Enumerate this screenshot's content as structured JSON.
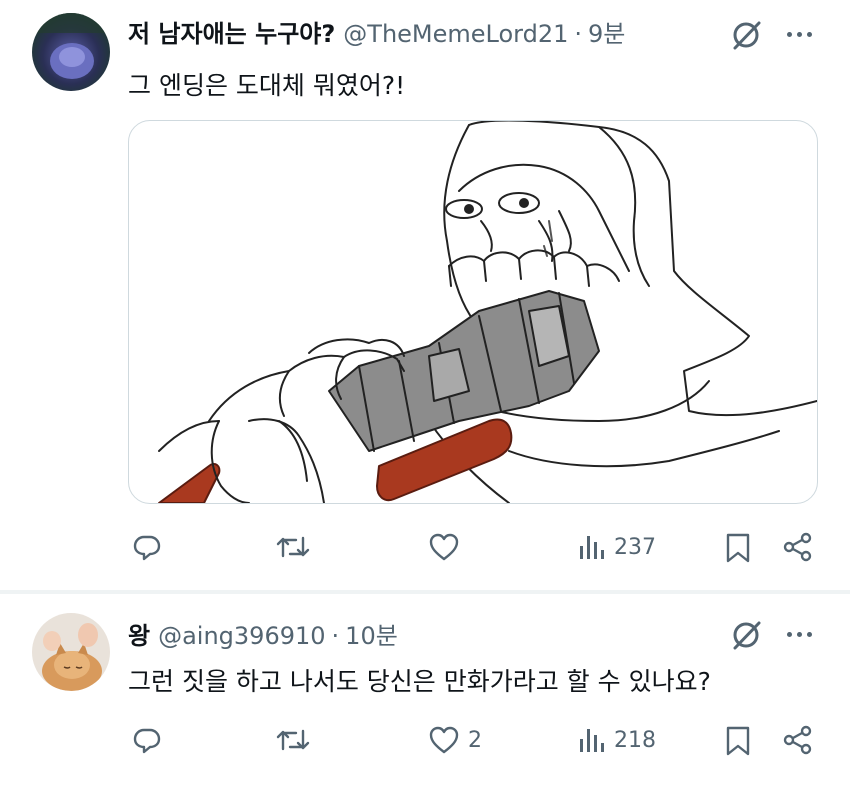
{
  "tweets": [
    {
      "author": "저 남자애는 누구야?",
      "handle": "@TheMemeLord21",
      "time": "9분",
      "text": "그 엔딩은 도대체 뭐였어?!",
      "likes": "",
      "views": "237"
    },
    {
      "author": "왕",
      "handle": "@aing396910",
      "time": "10분",
      "text": "그런 짓을 하고 나서도 당신은 만화가라고 할 수 있나요?",
      "likes": "2",
      "views": "218"
    }
  ],
  "separator": "·",
  "icons": {
    "reply": "reply-icon",
    "retweet": "retweet-icon",
    "like": "heart-icon",
    "views": "views-bar-icon",
    "bookmark": "bookmark-icon",
    "share": "share-icon",
    "grok": "grok-icon",
    "more": "more-dots-icon"
  },
  "colors": {
    "icon": "#536471",
    "divider": "#eff3f4",
    "media_border": "#cfd9de"
  }
}
